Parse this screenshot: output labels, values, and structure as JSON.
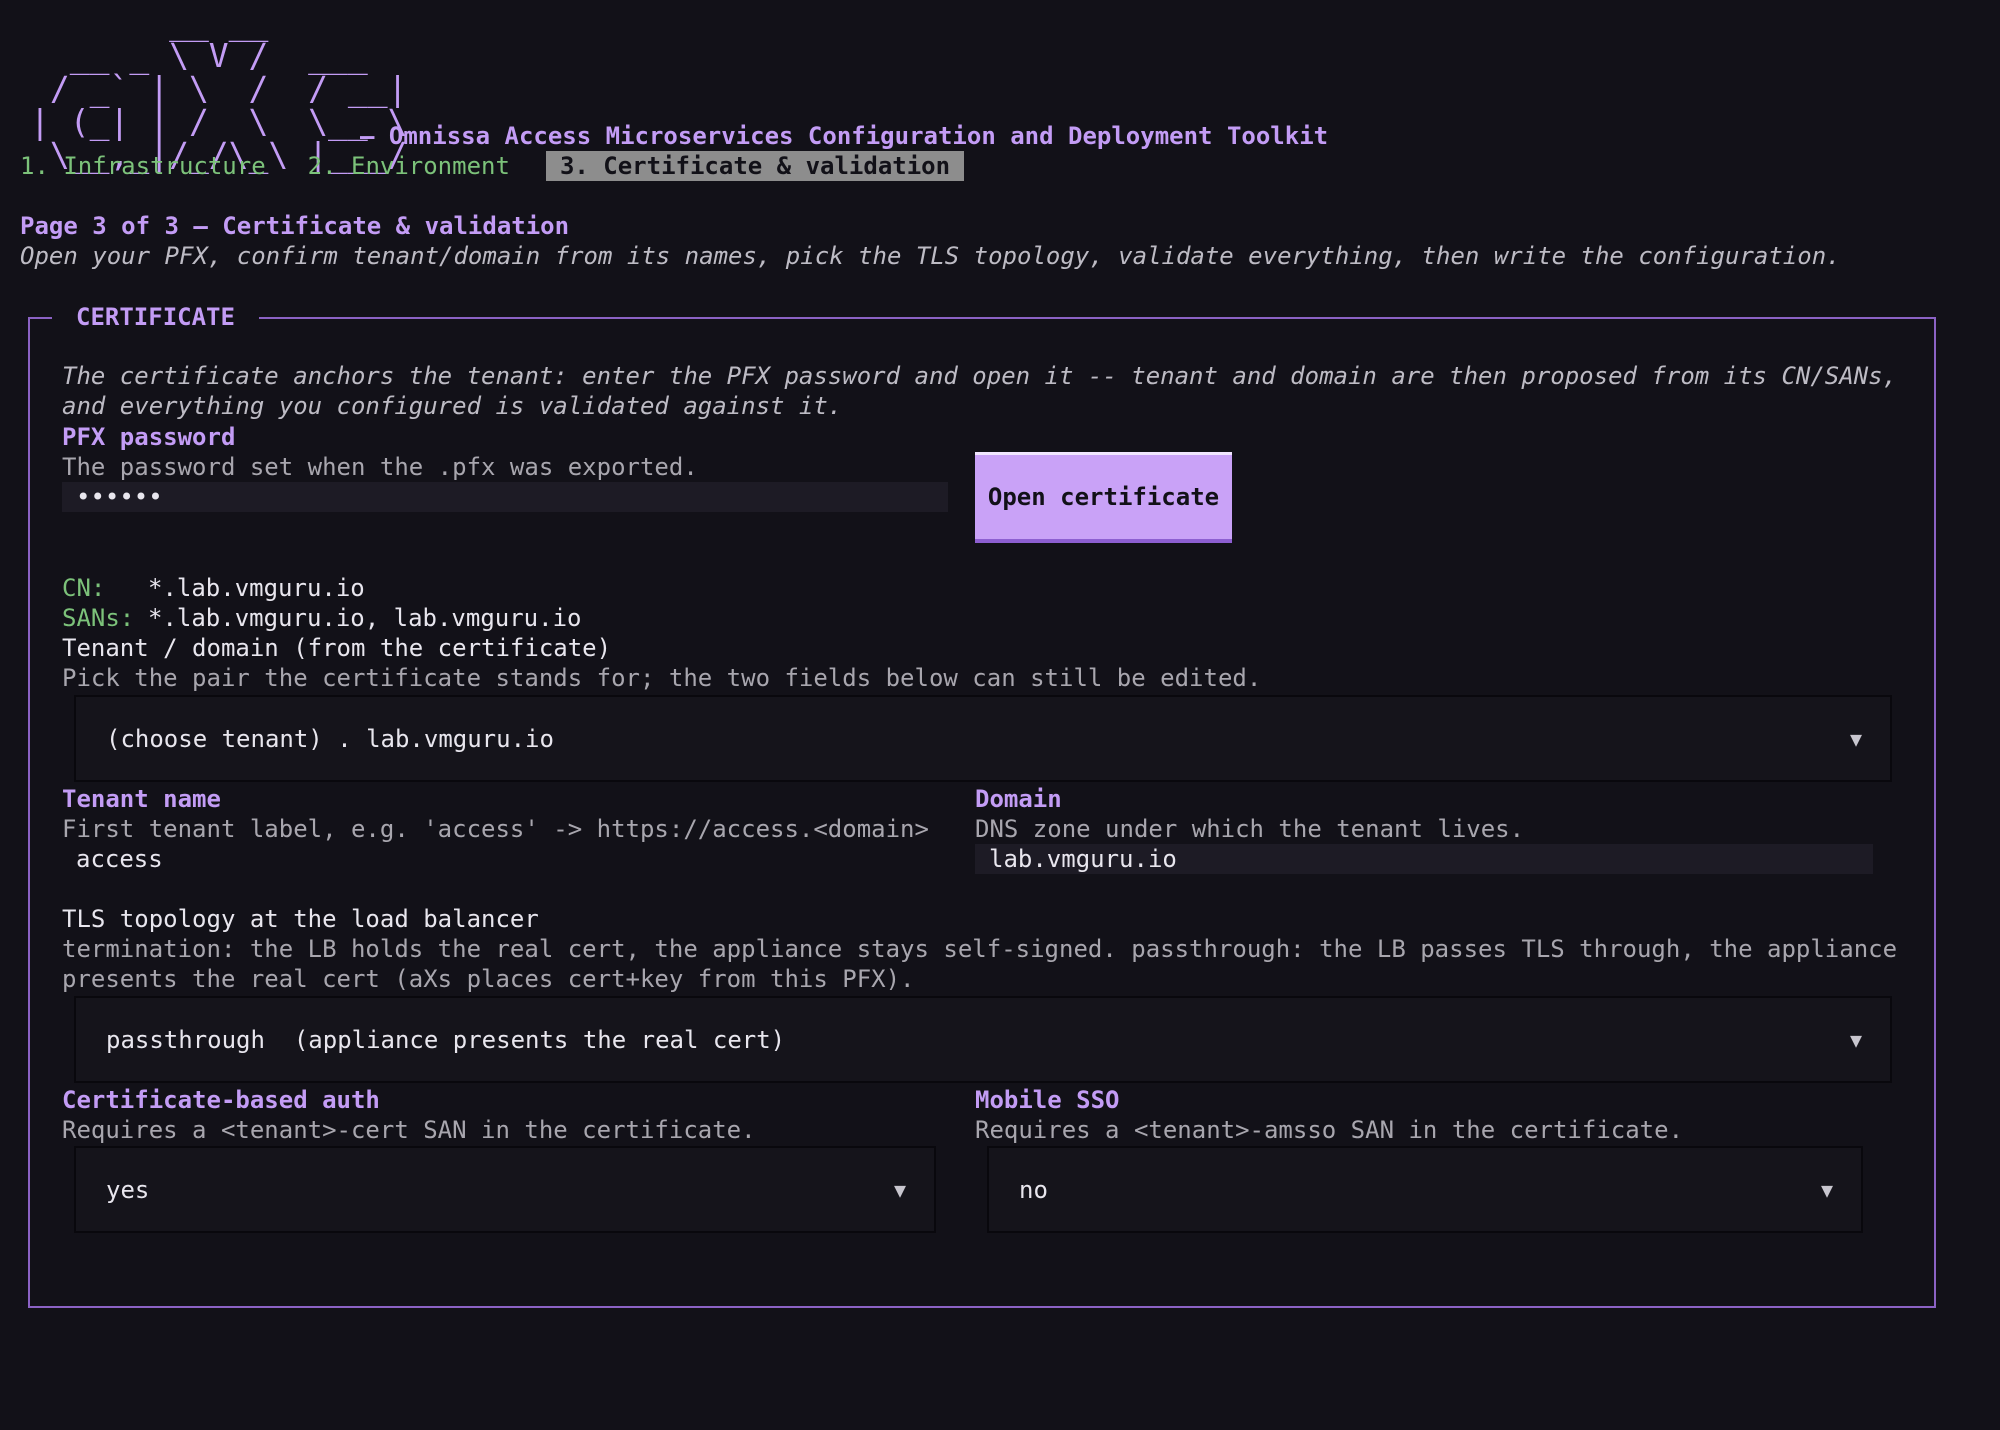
{
  "header": {
    "logo_ascii": "       __ __\n  __ _ \\ V /  ___\n / _` | \\  /  / __|\n| (_| | /  \\  \\__ \\\n \\__,_|/_/\\_\\ |___/",
    "toolkit_title": "– Omnissa Access Microservices Configuration and Deployment Toolkit",
    "tabs": [
      "1. Infrastructure",
      "2. Environment",
      "3. Certificate & validation"
    ]
  },
  "page": {
    "title": "Page 3 of 3 – Certificate & validation",
    "subtitle": "Open your PFX, confirm tenant/domain from its names, pick the TLS topology, validate everything, then write the configuration."
  },
  "certificate": {
    "section_title": "CERTIFICATE",
    "intro": "The certificate anchors the tenant: enter the PFX password and open it -- tenant and domain are then proposed from its CN/SANs, and everything you configured is validated against it.",
    "pfx_label": "PFX password",
    "pfx_help": "The password set when the .pfx was exported.",
    "pfx_value": "••••••",
    "open_button": "Open certificate",
    "cn_label": "CN:",
    "cn_value": "*.lab.vmguru.io",
    "sans_label": "SANs:",
    "sans_value": "*.lab.vmguru.io, lab.vmguru.io",
    "tenant_domain_label": "Tenant / domain (from the certificate)",
    "tenant_domain_help": "Pick the pair the certificate stands for; the two fields below can still be edited.",
    "tenant_domain_selected": "(choose tenant) . lab.vmguru.io",
    "tenant_label": "Tenant name",
    "tenant_help": "First tenant label, e.g. 'access' -> https://access.<domain>",
    "tenant_value": "access",
    "domain_label": "Domain",
    "domain_help": "DNS zone under which the tenant lives.",
    "domain_value": "lab.vmguru.io",
    "tls_label": "TLS topology at the load balancer",
    "tls_help": "termination: the LB holds the real cert, the appliance stays self-signed.  passthrough: the LB passes TLS through, the appliance presents the real cert (aXs places cert+key from this PFX).",
    "tls_selected": "passthrough  (appliance presents the real cert)",
    "cba_label": "Certificate-based auth",
    "cba_help": "Requires a <tenant>-cert SAN in the certificate.",
    "cba_selected": "yes",
    "sso_label": "Mobile SSO",
    "sso_help": "Requires a <tenant>-amsso SAN in the certificate.",
    "sso_selected": "no",
    "caret": "▼"
  },
  "colors": {
    "accent": "#c39cf5",
    "button": "#c9a2f7",
    "tab_inactive": "#7cc27a",
    "tab_active_bg": "#8d8d8d",
    "background": "#121118"
  }
}
